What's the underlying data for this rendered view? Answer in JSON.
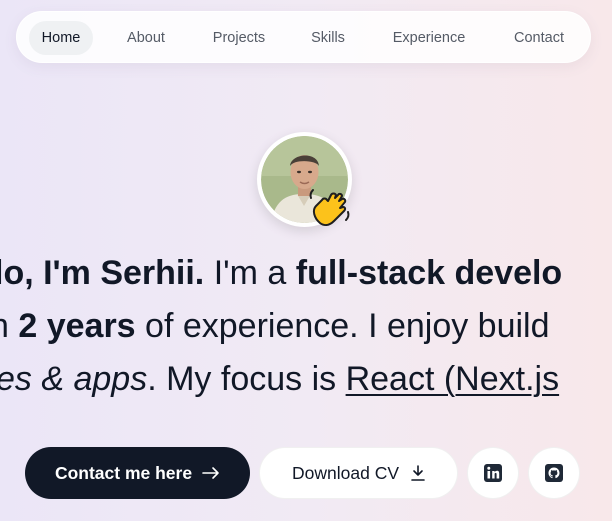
{
  "nav": {
    "items": [
      {
        "label": "Home",
        "active": true
      },
      {
        "label": "About"
      },
      {
        "label": "Projects"
      },
      {
        "label": "Skills"
      },
      {
        "label": "Experience"
      },
      {
        "label": "Contact"
      }
    ]
  },
  "hero": {
    "line1": {
      "greeting": "lo, I'm Serhii.",
      "mid": " I'm a ",
      "role": "full-stack develo"
    },
    "line2": {
      "pre": "n ",
      "years": "2 years",
      "rest": " of experience. I enjoy build"
    },
    "line3": {
      "italic": "es & apps",
      "mid": ". My focus is ",
      "focus": "React (Next.js"
    }
  },
  "buttons": {
    "contact_label": "Contact me here",
    "cv_label": "Download CV"
  },
  "icons": {
    "contact": "arrow-right-icon",
    "cv": "download-icon",
    "linkedin": "linkedin-icon",
    "github": "github-icon",
    "wave": "waving-hand-icon"
  },
  "colors": {
    "dark": "#111827",
    "nav_active_bg": "#eff1f3",
    "nav_text": "#555b66"
  }
}
